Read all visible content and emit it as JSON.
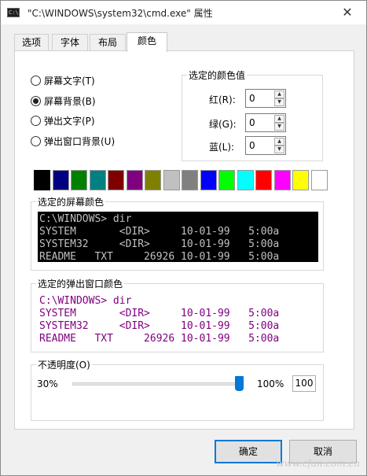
{
  "window": {
    "title": "\"C:\\WINDOWS\\system32\\cmd.exe\" 属性",
    "close_glyph": "✕",
    "icon_text": "C:\\"
  },
  "tabs": [
    {
      "label": "选项",
      "active": false
    },
    {
      "label": "字体",
      "active": false
    },
    {
      "label": "布局",
      "active": false
    },
    {
      "label": "颜色",
      "active": true
    }
  ],
  "radios": [
    {
      "label": "屏幕文字(T)",
      "checked": false
    },
    {
      "label": "屏幕背景(B)",
      "checked": true
    },
    {
      "label": "弹出文字(P)",
      "checked": false
    },
    {
      "label": "弹出窗口背景(U)",
      "checked": false
    }
  ],
  "color_values": {
    "group_label": "选定的颜色值",
    "red": {
      "label": "红(R):",
      "value": "0"
    },
    "green": {
      "label": "绿(G):",
      "value": "0"
    },
    "blue": {
      "label": "蓝(L):",
      "value": "0"
    }
  },
  "palette": {
    "colors": [
      "#000000",
      "#000080",
      "#008000",
      "#008080",
      "#800000",
      "#800080",
      "#808000",
      "#c0c0c0",
      "#808080",
      "#0000ff",
      "#00ff00",
      "#00ffff",
      "#ff0000",
      "#ff00ff",
      "#ffff00",
      "#ffffff"
    ],
    "selected_index": 0
  },
  "screen_preview": {
    "label": "选定的屏幕颜色",
    "lines": [
      "C:\\WINDOWS> dir",
      "SYSTEM       <DIR>     10-01-99   5:00a",
      "SYSTEM32     <DIR>     10-01-99   5:00a",
      "README   TXT     26926 10-01-99   5:00a"
    ],
    "background": "#000000",
    "text_color": "#c0c0c0"
  },
  "popup_preview": {
    "label": "选定的弹出窗口颜色",
    "lines": [
      "C:\\WINDOWS> dir",
      "SYSTEM       <DIR>     10-01-99   5:00a",
      "SYSTEM32     <DIR>     10-01-99   5:00a",
      "README   TXT     26926 10-01-99   5:00a"
    ],
    "background": "#ffffff",
    "text_color": "#800080"
  },
  "opacity": {
    "label": "不透明度(O)",
    "min_label": "30%",
    "max_label": "100%",
    "value": "100",
    "slider_fraction": 1.0
  },
  "buttons": {
    "ok": "确定",
    "cancel": "取消"
  },
  "watermark": "www.cfan.com.cn",
  "accent_color": "#0078d7"
}
